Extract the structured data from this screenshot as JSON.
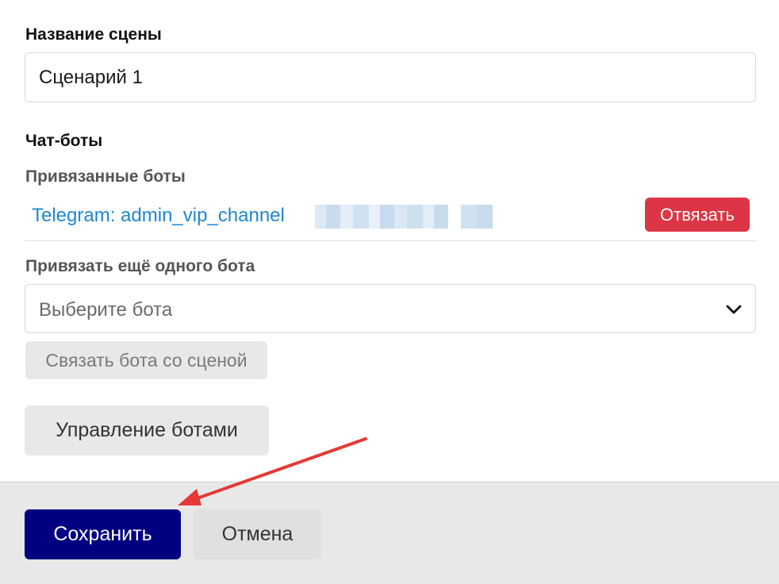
{
  "scene": {
    "name_label": "Название сцены",
    "name_value": "Сценарий 1"
  },
  "chatbots": {
    "section_title": "Чат-боты",
    "linked_label": "Привязанные боты",
    "linked_bots": [
      {
        "name": "Telegram: admin_vip_channel",
        "unlink_label": "Отвязать"
      }
    ],
    "add_label": "Привязать ещё одного бота",
    "select_placeholder": "Выберите бота",
    "select_icon": "chevron-down-icon",
    "link_button_label": "Связать бота со сценой",
    "manage_button_label": "Управление ботами"
  },
  "footer": {
    "save_label": "Сохранить",
    "cancel_label": "Отмена"
  },
  "colors": {
    "primary": "#000080",
    "danger": "#dc3545",
    "link": "#1e88d2",
    "annotation_arrow": "#e53935"
  }
}
